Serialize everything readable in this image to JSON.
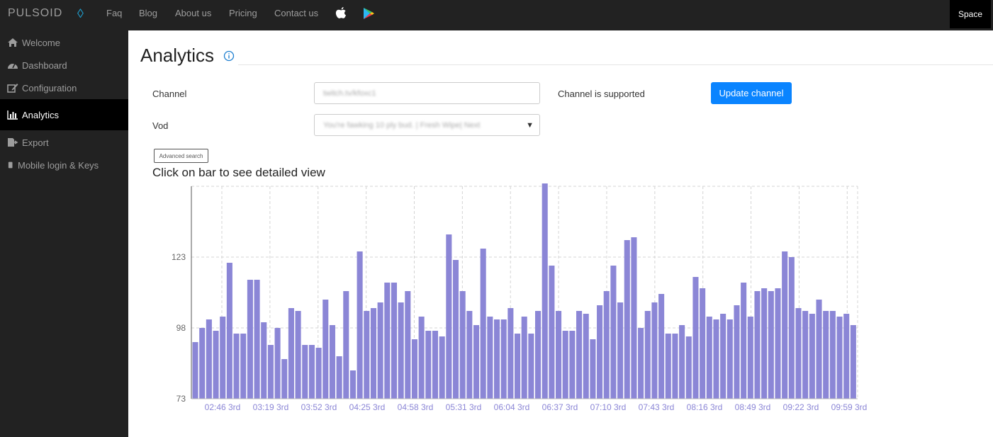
{
  "topbar": {
    "brand": "PULSOID",
    "diamond_icon": "diamond-icon",
    "links": [
      "Faq",
      "Blog",
      "About us",
      "Pricing",
      "Contact us"
    ],
    "space_label": "Space"
  },
  "sidebar": {
    "items": [
      {
        "label": "Welcome",
        "icon": "home-icon"
      },
      {
        "label": "Dashboard",
        "icon": "dashboard-icon"
      },
      {
        "label": "Configuration",
        "icon": "edit-icon"
      },
      {
        "label": "Analytics",
        "icon": "bar-chart-icon"
      },
      {
        "label": "Export",
        "icon": "export-icon"
      },
      {
        "label": "Mobile login & Keys",
        "icon": "mobile-icon"
      }
    ]
  },
  "page": {
    "title": "Analytics",
    "channel_label": "Channel",
    "channel_value": "twitch.tv/kfoxc1",
    "channel_status": "Channel is supported",
    "update_button": "Update channel",
    "vod_label": "Vod",
    "vod_value": "You're fawking 10 ply bud. | Fresh Wipe| Next",
    "advanced_search": "Advanced search",
    "subheading": "Click on bar to see detailed view"
  },
  "colors": {
    "bar": "#8b86d6",
    "accent": "#0a84ff",
    "sidebar_bg": "#222222"
  },
  "chart_data": {
    "type": "bar",
    "ylim": [
      73,
      148
    ],
    "yticks": [
      73,
      98,
      123
    ],
    "grid": true,
    "xtick_labels": [
      "02:46 3rd",
      "03:19 3rd",
      "03:52 3rd",
      "04:25 3rd",
      "04:58 3rd",
      "05:31 3rd",
      "06:04 3rd",
      "06:37 3rd",
      "07:10 3rd",
      "07:43 3rd",
      "08:16 3rd",
      "08:49 3rd",
      "09:22 3rd",
      "09:59 3rd"
    ],
    "values": [
      93,
      98,
      101,
      97,
      102,
      121,
      96,
      96,
      115,
      115,
      100,
      92,
      98,
      87,
      105,
      104,
      92,
      92,
      91,
      108,
      99,
      88,
      111,
      83,
      125,
      104,
      105,
      107,
      114,
      114,
      107,
      111,
      94,
      102,
      97,
      97,
      95,
      131,
      122,
      111,
      104,
      99,
      126,
      102,
      101,
      101,
      105,
      96,
      102,
      96,
      104,
      149,
      120,
      104,
      97,
      97,
      104,
      103,
      94,
      106,
      111,
      120,
      107,
      129,
      130,
      98,
      104,
      107,
      110,
      96,
      96,
      99,
      95,
      116,
      112,
      102,
      101,
      103,
      101,
      106,
      114,
      102,
      111,
      112,
      111,
      112,
      125,
      123,
      105,
      104,
      103,
      108,
      104,
      104,
      102,
      103,
      99
    ]
  }
}
